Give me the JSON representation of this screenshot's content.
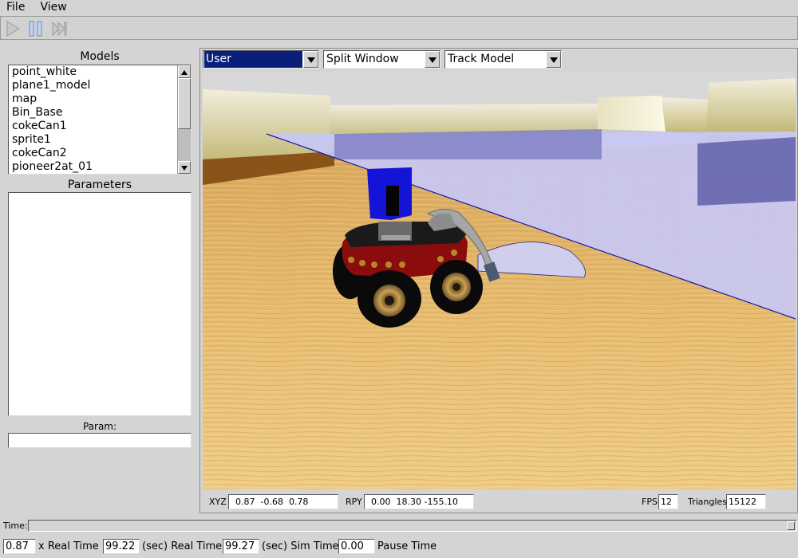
{
  "menu": {
    "file": "File",
    "view": "View"
  },
  "toolbar": {
    "play_icon": "play-icon",
    "pause_icon": "pause-icon",
    "step_icon": "step-forward-icon"
  },
  "models": {
    "title": "Models",
    "items": [
      "point_white",
      "plane1_model",
      "map",
      "Bin_Base",
      "cokeCan1",
      "sprite1",
      "cokeCan2",
      "pioneer2at_01"
    ]
  },
  "parameters": {
    "title": "Parameters"
  },
  "param": {
    "label": "Param:",
    "value": ""
  },
  "view_controls": {
    "camera": "User",
    "layout": "Split Window",
    "mode": "Track Model"
  },
  "readouts": {
    "xyz_label": "XYZ",
    "xyz_value": "0.87  -0.68  0.78",
    "rpy_label": "RPY",
    "rpy_value": "0.00  18.30 -155.10",
    "fps_label": "FPS",
    "fps_value": "12",
    "triangles_label": "Triangles",
    "triangles_value": "15122"
  },
  "time": {
    "label": "Time:",
    "slider_position": 1.0,
    "real_time_factor": "0.87",
    "real_time_factor_label": "x Real Time",
    "real_time": "99.22",
    "real_time_label": "(sec) Real Time",
    "sim_time": "99.27",
    "sim_time_label": "(sec) Sim Time",
    "pause_time": "0.00",
    "pause_time_label": "Pause Time"
  },
  "colors": {
    "window_bg": "#d4d4d4",
    "selection": "#0a1f7a",
    "floor": "#e2b66c",
    "plane": "#c8c8f5",
    "robot_body": "#8a0c0c",
    "robot_arm": "#a6a6a6",
    "robot_head": "#1414d8"
  }
}
